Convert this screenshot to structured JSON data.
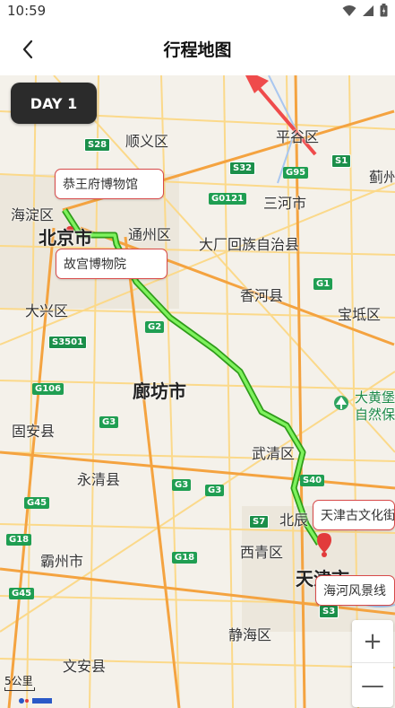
{
  "status_bar": {
    "time": "10:59"
  },
  "nav": {
    "title": "行程地图"
  },
  "map": {
    "day_badge": "DAY 1",
    "pois": [
      {
        "name": "恭王府博物馆"
      },
      {
        "name": "故宫博物院"
      },
      {
        "name": "天津古文化街"
      },
      {
        "name": "海河风景线"
      }
    ],
    "places": {
      "shunyi": "顺义区",
      "pinggu": "平谷区",
      "jixian": "蓟州",
      "haidian": "海淀区",
      "beijing": "北京市",
      "tongzhou": "通州区",
      "sanhe": "三河市",
      "dachang": "大厂回族自治县",
      "xianghe": "香河县",
      "baodi": "宝坻区",
      "daxing": "大兴区",
      "langfang": "廊坊市",
      "gu_an": "固安县",
      "yongqing": "永清县",
      "wuqing": "武清区",
      "bazhou": "霸州市",
      "xiqing": "西青区",
      "tianjin": "天津市",
      "jinghai": "静海区",
      "wen_an": "文安县",
      "beichen": "北辰",
      "dahuangbao": "大黄堡",
      "ziran": "自然保"
    },
    "shields": [
      "S28",
      "G95",
      "S32",
      "S1",
      "G0121",
      "G1",
      "G2",
      "S3501",
      "G106",
      "G3",
      "G45",
      "S40",
      "S7",
      "G18",
      "G3",
      "G18",
      "G45",
      "G3",
      "S3"
    ],
    "scale_label": "5公里",
    "zoom_in": "+",
    "zoom_out": "—"
  }
}
